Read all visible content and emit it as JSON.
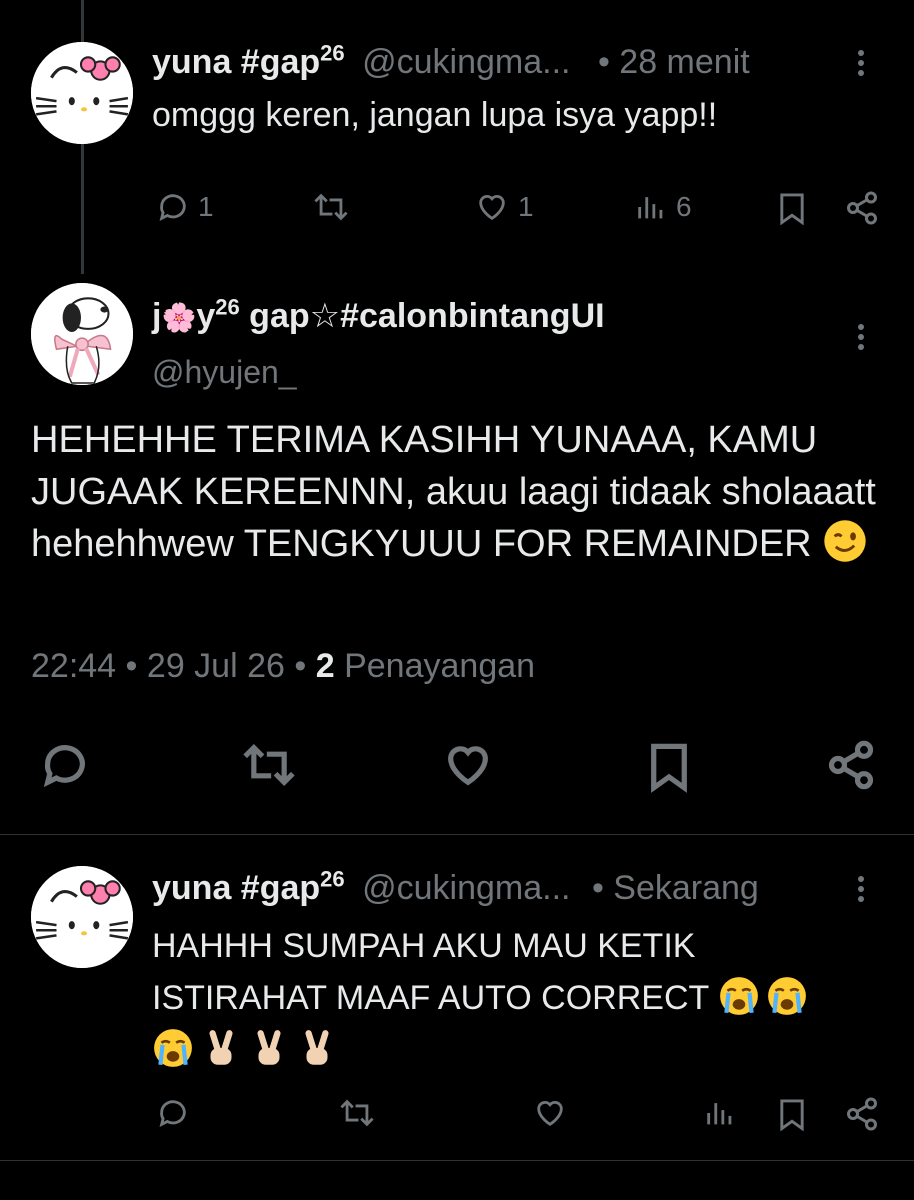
{
  "reply1": {
    "name": "yuna #gap",
    "name_sup": "26",
    "handle": "@cukingma...",
    "time": "• 28 menit",
    "text": "omggg keren, jangan lupa isya yapp!!",
    "replies": "1",
    "likes": "1",
    "views": "6"
  },
  "main": {
    "name_pre": "j",
    "name_flower": "🌸",
    "name_post": "y",
    "name_sup": "26",
    "name_rest": " gap☆#calonbintangUI",
    "handle": "@hyujen_",
    "text": "HEHEHHE TERIMA KASIHH YUNAAA, KAMU JUGAAK KEREENNN, akuu laagi tidaak sholaaatt hehehhwew TENGKYUUU FOR REMAINDER",
    "time": "22:44",
    "date": "29 Jul 26",
    "views_count": "2",
    "views_label": "Penayangan"
  },
  "reply2": {
    "name": "yuna #gap",
    "name_sup": "26",
    "handle": "@cukingma...",
    "time": "• Sekarang",
    "text_line1": "HAHHH SUMPAH AKU MAU KETIK",
    "text_line2": "ISTIRAHAT MAAF AUTO CORRECT"
  },
  "icons": {
    "reply": "reply-icon",
    "repost": "repost-icon",
    "like": "heart-icon",
    "views": "views-icon",
    "bookmark": "bookmark-icon",
    "share": "share-icon",
    "more": "more-vertical-icon"
  },
  "colors": {
    "background": "#000000",
    "text": "#e7e9ea",
    "muted": "#71767b",
    "divider": "#2f3336"
  }
}
